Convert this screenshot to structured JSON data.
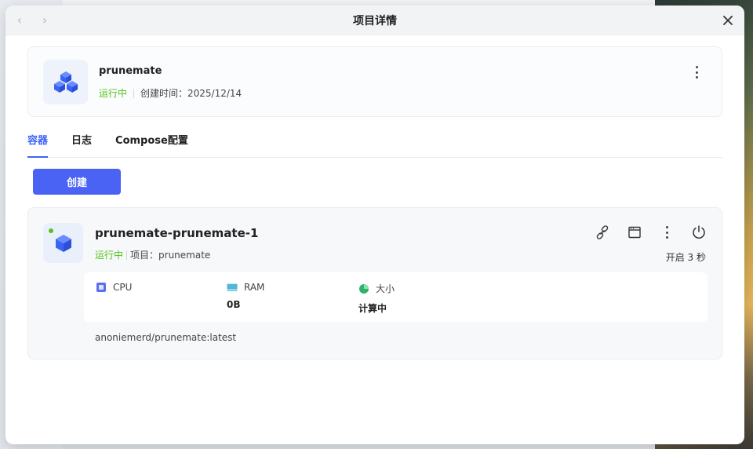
{
  "window": {
    "title": "项目详情"
  },
  "project": {
    "name": "prunemate",
    "status": "运行中",
    "created": "创建时间：2025/12/14"
  },
  "tabs": [
    {
      "label": "容器",
      "active": true
    },
    {
      "label": "日志",
      "active": false
    },
    {
      "label": "Compose配置",
      "active": false
    }
  ],
  "create_button": "创建",
  "container": {
    "name": "prunemate-prunemate-1",
    "status": "运行中",
    "project": "项目：prunemate",
    "uptime": "开启 3 秒",
    "image": "anoniemerd/prunemate:latest",
    "stats": {
      "cpu_label": "CPU",
      "ram_label": "RAM",
      "ram_value": "0B",
      "size_label": "大小",
      "size_value": "计算中"
    }
  },
  "colors": {
    "accent": "#4a63f5",
    "running": "#52c41a"
  },
  "icons": {
    "project": "cubes-icon",
    "container": "cube-icon",
    "link": "link-icon",
    "terminal": "window-icon",
    "more": "kebab-icon",
    "power": "power-icon"
  }
}
